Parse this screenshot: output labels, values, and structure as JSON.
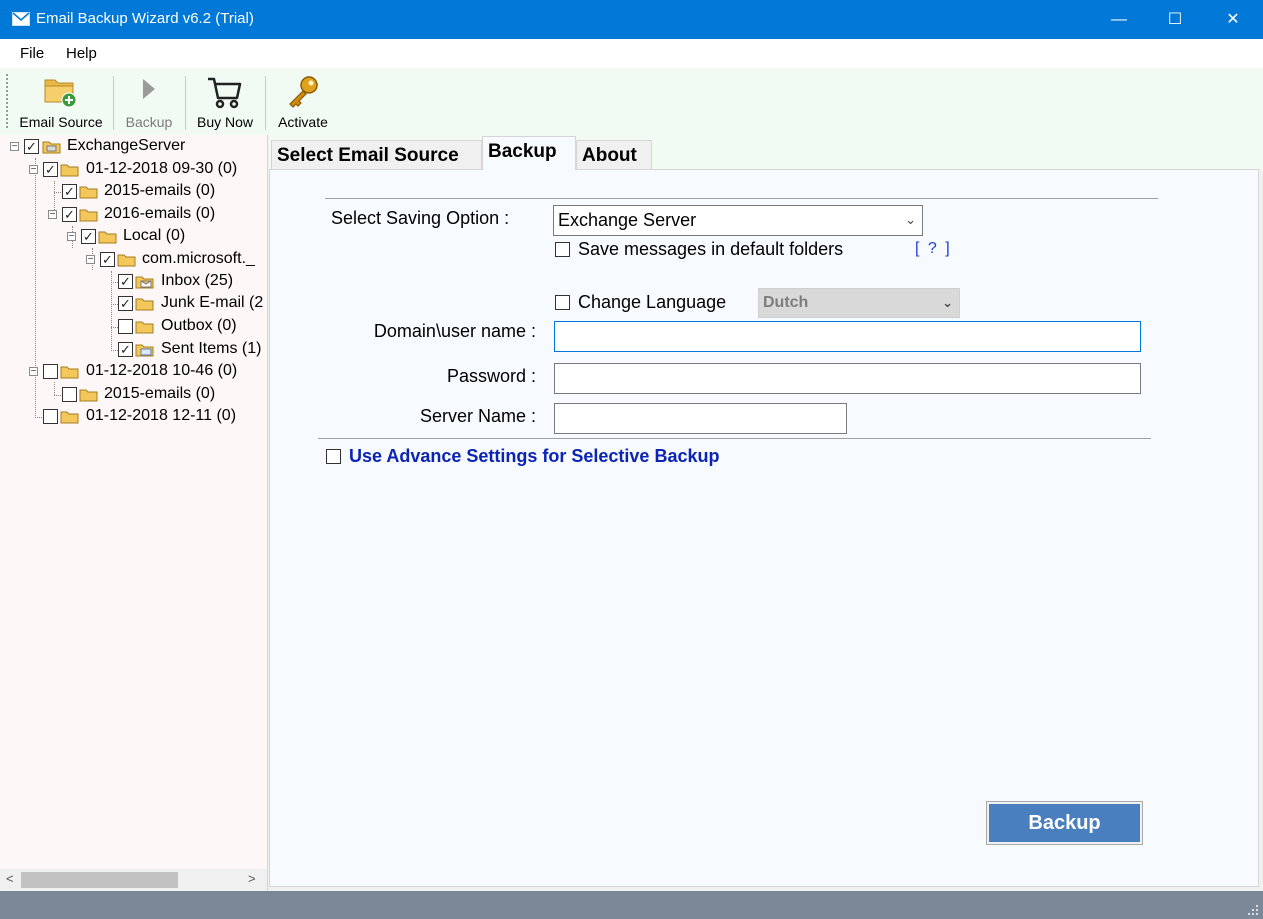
{
  "window": {
    "title": "Email Backup Wizard v6.2 (Trial)",
    "controls": {
      "minimize": "—",
      "maximize": "☐",
      "close": "✕"
    }
  },
  "menu": {
    "file": "File",
    "help": "Help"
  },
  "toolbar": {
    "email_source": "Email Source",
    "backup": "Backup",
    "buy_now": "Buy Now",
    "activate": "Activate"
  },
  "tree": {
    "nodes": [
      {
        "label": "ExchangeServer",
        "checked": true
      },
      {
        "label": "01-12-2018 09-30 (0)",
        "checked": true
      },
      {
        "label": "2015-emails (0)",
        "checked": true
      },
      {
        "label": "2016-emails (0)",
        "checked": true
      },
      {
        "label": "Local (0)",
        "checked": true
      },
      {
        "label": "com.microsoft._",
        "checked": true
      },
      {
        "label": "Inbox (25)",
        "checked": true
      },
      {
        "label": "Junk E-mail (2",
        "checked": true
      },
      {
        "label": "Outbox (0)",
        "checked": false
      },
      {
        "label": "Sent Items (1)",
        "checked": true
      },
      {
        "label": "01-12-2018 10-46 (0)",
        "checked": false
      },
      {
        "label": "2015-emails (0)",
        "checked": false
      },
      {
        "label": "01-12-2018 12-11 (0)",
        "checked": false
      }
    ]
  },
  "tabs": {
    "select_email_source": "Select Email Source",
    "backup": "Backup",
    "about": "About",
    "active": "Backup"
  },
  "form": {
    "saving_option_label": "Select Saving Option :",
    "saving_option_value": "Exchange Server",
    "save_default_folders_label": "Save messages in default folders",
    "help_link": "[ ? ]",
    "change_language_label": "Change Language",
    "language_value": "Dutch",
    "domain_user_label": "Domain\\user name :",
    "password_label": "Password :",
    "server_name_label": "Server Name :",
    "advance_settings_label": "Use Advance Settings for Selective Backup",
    "backup_button": "Backup"
  },
  "colors": {
    "titlebar": "#0078d7",
    "toolbar_bg": "#f2fbf3",
    "backup_button": "#4a7fbf",
    "advance_link": "#0b24b5",
    "statusbar": "#7b8898"
  }
}
